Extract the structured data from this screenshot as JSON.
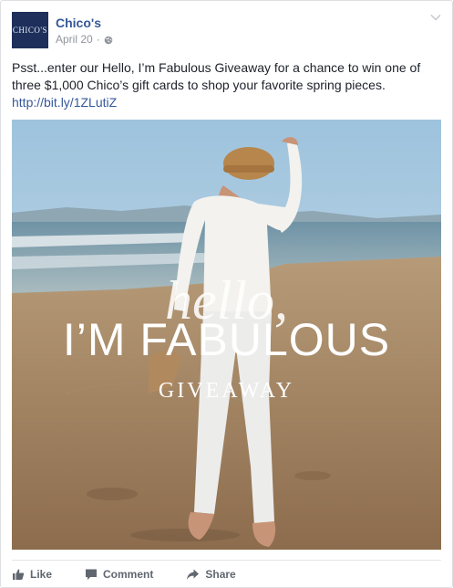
{
  "post": {
    "page_name": "Chico's",
    "avatar_text": "CHICO'S",
    "date": "April 20",
    "separator": "·",
    "privacy_icon": "globe-icon",
    "menu_icon": "chevron-down-icon",
    "body_text": "Psst...enter our Hello, I’m Fabulous Giveaway for a chance to win one of three $1,000 Chico’s gift cards to shop your favorite spring pieces.",
    "link": "http://bit.ly/1ZLutiZ"
  },
  "image": {
    "hello": "hello,",
    "headline": "I’M FABULOUS",
    "sub": "GIVEAWAY"
  },
  "actions": {
    "like": "Like",
    "comment": "Comment",
    "share": "Share"
  },
  "colors": {
    "link": "#365899",
    "avatar_bg": "#1d2f5a",
    "action_text": "#606770"
  }
}
